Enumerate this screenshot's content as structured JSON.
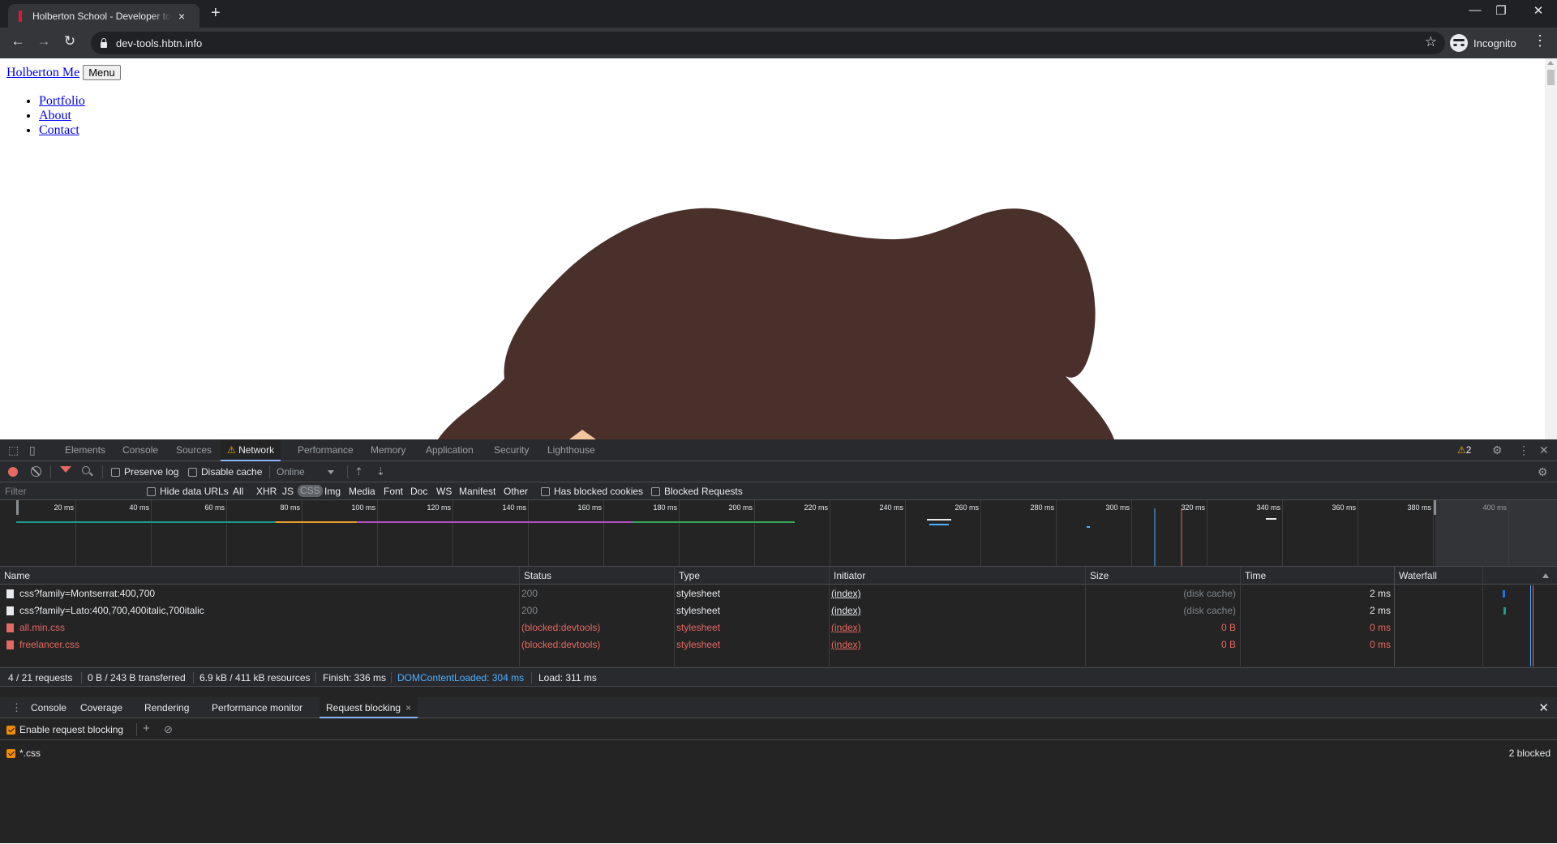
{
  "browser": {
    "tab_title": "Holberton School - Developer tools",
    "tab_close": "×",
    "new_tab": "+",
    "url": "dev-tools.hbtn.info",
    "profile_label": "Incognito",
    "controls": {
      "minimize": "—",
      "restore": "❐",
      "close": "✕"
    },
    "nav": {
      "back": "←",
      "forward": "→",
      "reload": "↻",
      "star": "☆",
      "menu": "⋮"
    }
  },
  "page": {
    "brand_link": "Holberton Me",
    "menu_button": "Menu",
    "nav_links": [
      "Portfolio",
      "About",
      "Contact"
    ],
    "illustration_colors": {
      "hair": "#4a302b",
      "skin": "#f2c59c"
    }
  },
  "devtools": {
    "tabs": [
      "Elements",
      "Console",
      "Sources",
      "Network",
      "Performance",
      "Memory",
      "Application",
      "Security",
      "Lighthouse"
    ],
    "active_tab": "Network",
    "warning_count": "2",
    "network_toolbar": {
      "preserve_log": "Preserve log",
      "disable_cache": "Disable cache",
      "throttling": "Online"
    },
    "filter": {
      "placeholder": "Filter",
      "hide_data_urls": "Hide data URLs",
      "types": [
        "All",
        "XHR",
        "JS",
        "CSS",
        "Img",
        "Media",
        "Font",
        "Doc",
        "WS",
        "Manifest",
        "Other"
      ],
      "active_type": "CSS",
      "has_blocked_cookies": "Has blocked cookies",
      "blocked_requests": "Blocked Requests"
    },
    "overview": {
      "tick_labels": [
        "20 ms",
        "40 ms",
        "60 ms",
        "80 ms",
        "100 ms",
        "120 ms",
        "140 ms",
        "160 ms",
        "180 ms",
        "200 ms",
        "220 ms",
        "240 ms",
        "260 ms",
        "280 ms",
        "300 ms",
        "320 ms",
        "340 ms",
        "360 ms",
        "380 ms",
        "400 ms"
      ]
    },
    "table": {
      "headers": [
        "Name",
        "Status",
        "Type",
        "Initiator",
        "Size",
        "Time",
        "Waterfall"
      ],
      "rows": [
        {
          "name": "css?family=Montserrat:400,700",
          "status": "200",
          "type": "stylesheet",
          "initiator": "(index)",
          "size": "(disk cache)",
          "time": "2 ms",
          "blocked": false
        },
        {
          "name": "css?family=Lato:400,700,400italic,700italic",
          "status": "200",
          "type": "stylesheet",
          "initiator": "(index)",
          "size": "(disk cache)",
          "time": "2 ms",
          "blocked": false
        },
        {
          "name": "all.min.css",
          "status": "(blocked:devtools)",
          "type": "stylesheet",
          "initiator": "(index)",
          "size": "0 B",
          "time": "0 ms",
          "blocked": true
        },
        {
          "name": "freelancer.css",
          "status": "(blocked:devtools)",
          "type": "stylesheet",
          "initiator": "(index)",
          "size": "0 B",
          "time": "0 ms",
          "blocked": true
        }
      ]
    },
    "summary": {
      "requests": "4 / 21 requests",
      "transferred": "0 B / 243 B transferred",
      "resources": "6.9 kB / 411 kB resources",
      "finish": "Finish: 336 ms",
      "dom_content_loaded": "DOMContentLoaded: 304 ms",
      "load": "Load: 311 ms"
    },
    "drawer": {
      "tabs": [
        "Console",
        "Coverage",
        "Rendering",
        "Performance monitor",
        "Request blocking"
      ],
      "active_tab": "Request blocking",
      "enable_request_blocking": "Enable request blocking",
      "patterns": [
        {
          "pattern": "*.css",
          "count": "2 blocked"
        }
      ]
    },
    "colors": {
      "accent": "#8ab4f8",
      "error": "#e46962",
      "dom_content_loaded": "#4db1ff",
      "checkbox": "#f28b00"
    }
  }
}
